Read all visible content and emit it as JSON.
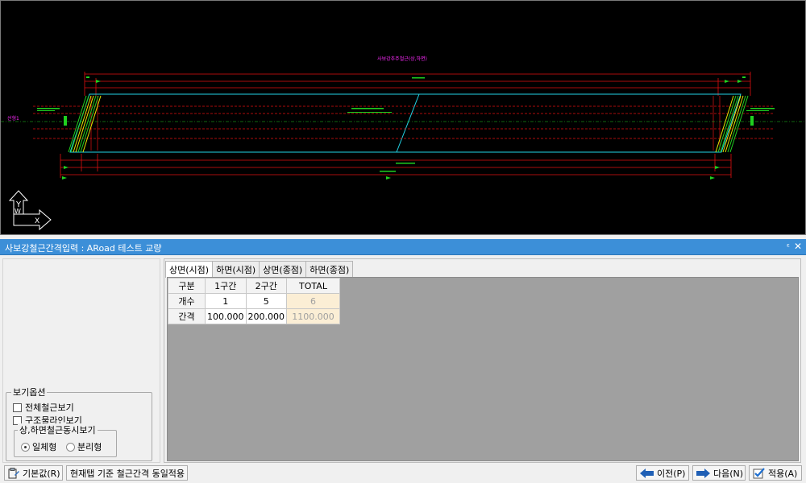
{
  "cad": {
    "drawing_title": "사보강추주철근(상,하면)",
    "axis_y": "Y",
    "axis_x": "X",
    "axis_w": "W",
    "left_label": "선형1"
  },
  "panel": {
    "title": "사보강철근간격입력 : ARoad 테스트 교량",
    "pin_glyph": "ᵖ",
    "close_glyph": "✕"
  },
  "view_options": {
    "group_label": "보기옵션",
    "show_all_rebar": "전체철근보기",
    "show_structure_lines": "구조물라인보기",
    "simultaneous_group_label": "상,하면철근동시보기",
    "radio_unified": "일체형",
    "radio_separated": "분리형",
    "selected": "일체형"
  },
  "tabs": [
    {
      "label": "상면(시점)",
      "active": true
    },
    {
      "label": "하면(시점)",
      "active": false
    },
    {
      "label": "상면(종점)",
      "active": false
    },
    {
      "label": "하면(종점)",
      "active": false
    }
  ],
  "grid": {
    "headers": [
      "구분",
      "1구간",
      "2구간",
      "TOTAL"
    ],
    "rows": [
      {
        "label": "개수",
        "values": [
          "1",
          "5"
        ],
        "total": "6"
      },
      {
        "label": "간격",
        "values": [
          "100.000",
          "200.000"
        ],
        "total": "1100.000"
      }
    ]
  },
  "buttons": {
    "default": "기본값(R)",
    "apply_same": "현재탭 기준 철근간격 동일적용",
    "prev": "이전(P)",
    "next": "다음(N)",
    "apply": "적용(A)"
  },
  "colors": {
    "cad_bg": "#000000",
    "red_line": "#e01010",
    "cyan_line": "#22d3e6",
    "green_rebar": "#1fd11f",
    "yellow_rebar": "#e6e600",
    "magenta_text": "#ff2bff",
    "panel_title_bg": "#3c8fd8"
  }
}
